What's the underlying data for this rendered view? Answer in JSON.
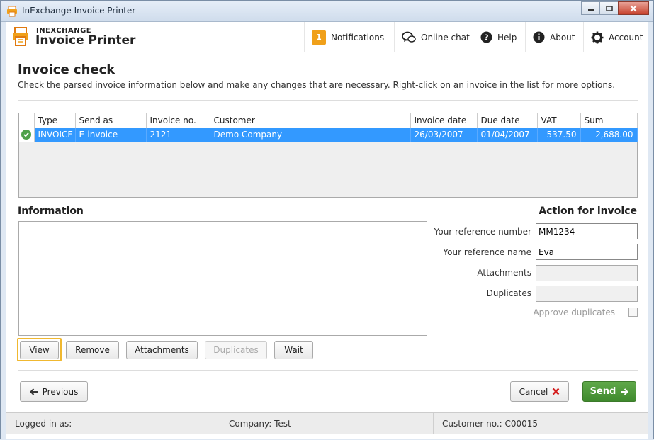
{
  "window": {
    "title": "InExchange Invoice Printer"
  },
  "brand": {
    "small": "INEXCHANGE",
    "big": "Invoice Printer"
  },
  "nav": {
    "notifications_count": "1",
    "notifications": "Notifications",
    "online_chat": "Online chat",
    "help": "Help",
    "about": "About",
    "account": "Account"
  },
  "page": {
    "title": "Invoice check",
    "description": "Check the parsed invoice information below and make any changes that are necessary. Right-click on an invoice in the list for more options."
  },
  "table": {
    "columns": [
      "Type",
      "Send as",
      "Invoice no.",
      "Customer",
      "Invoice date",
      "Due date",
      "VAT",
      "Sum"
    ],
    "rows": [
      {
        "status": "ok",
        "type": "INVOICE",
        "send_as": "E-invoice",
        "invoice_no": "2121",
        "customer": "Demo Company",
        "invoice_date": "26/03/2007",
        "due_date": "01/04/2007",
        "vat": "537.50",
        "sum": "2,688.00"
      }
    ]
  },
  "information": {
    "title": "Information"
  },
  "action": {
    "title": "Action for invoice",
    "ref_number_label": "Your reference number",
    "ref_number_value": "MM1234",
    "ref_name_label": "Your reference name",
    "ref_name_value": "Eva",
    "attachments_label": "Attachments",
    "attachments_value": "",
    "duplicates_label": "Duplicates",
    "duplicates_value": "",
    "approve_duplicates_label": "Approve duplicates"
  },
  "buttons": {
    "view": "View",
    "remove": "Remove",
    "attachments": "Attachments",
    "duplicates": "Duplicates",
    "wait": "Wait",
    "previous": "Previous",
    "cancel": "Cancel",
    "send": "Send"
  },
  "status": {
    "logged_in": "Logged in as:",
    "company": "Company: Test",
    "customer_no": "Customer no.: C00015"
  },
  "colors": {
    "selection": "#3399ff",
    "send_button": "#4f9a3b",
    "badge": "#f0a01a",
    "cancel_x": "#d42020"
  }
}
